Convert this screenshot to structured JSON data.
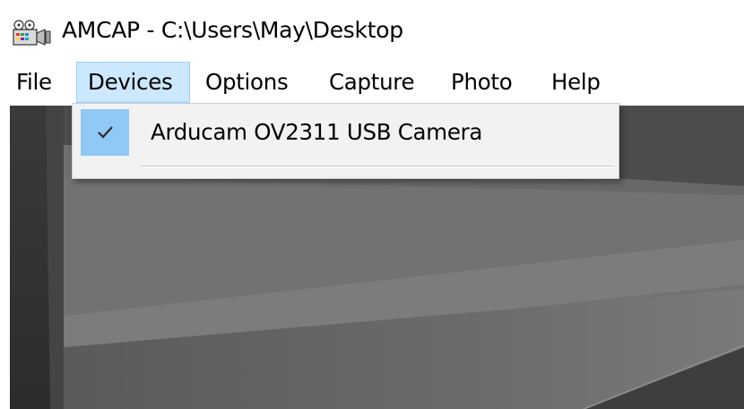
{
  "window": {
    "title": "AMCAP - C:\\Users\\May\\Desktop",
    "icon": "amcap-camera-icon"
  },
  "menu": {
    "items": [
      {
        "label": "File"
      },
      {
        "label": "Devices",
        "active": true
      },
      {
        "label": "Options"
      },
      {
        "label": "Capture"
      },
      {
        "label": "Photo"
      },
      {
        "label": "Help"
      }
    ]
  },
  "devices_menu": {
    "items": [
      {
        "label": "Arducam OV2311 USB Camera",
        "checked": true,
        "icon": "checkmark-icon"
      }
    ]
  },
  "colors": {
    "menu_active_bg": "#cce8ff",
    "menu_active_border": "#99d1ff",
    "check_highlight": "#90c8f6",
    "dropdown_bg": "#f2f2f2"
  }
}
